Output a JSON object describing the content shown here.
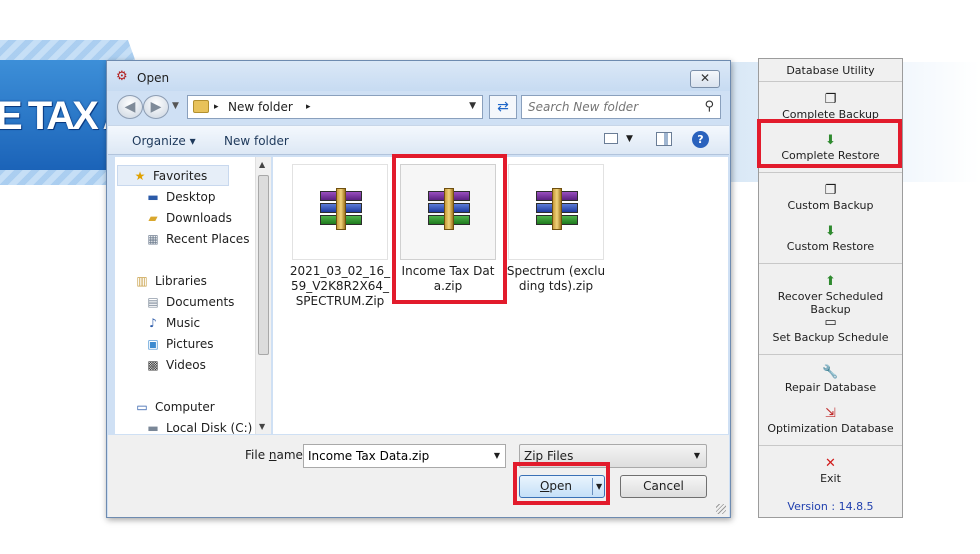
{
  "background": {
    "banner_title": "E TAX AU"
  },
  "utility": {
    "title": "Database Utility",
    "buttons": [
      {
        "label": "Complete Backup",
        "icon": "copy-icon"
      },
      {
        "label": "Complete Restore",
        "icon": "restore-icon"
      },
      {
        "label": "Custom Backup",
        "icon": "copy-icon"
      },
      {
        "label": "Custom Restore",
        "icon": "restore-icon"
      },
      {
        "label": "Recover Scheduled Backup",
        "icon": "recover-icon"
      },
      {
        "label": "Set Backup Schedule",
        "icon": "calendar-icon"
      },
      {
        "label": "Repair Database",
        "icon": "wrench-icon"
      },
      {
        "label": "Optimization Database",
        "icon": "optimize-icon"
      },
      {
        "label": "Exit",
        "icon": "x-icon"
      }
    ],
    "version": "Version : 14.8.5"
  },
  "dialog": {
    "title": "Open",
    "close_glyph": "✕",
    "address": {
      "crumb_sep": "▸",
      "crumb": "New folder",
      "search_placeholder": "Search New folder"
    },
    "toolbar": {
      "organize": "Organize ▾",
      "new_folder": "New folder",
      "help": "?"
    },
    "nav": [
      {
        "label": "Favorites",
        "icon": "star-icon"
      },
      {
        "label": "Desktop",
        "icon": "desktop-icon"
      },
      {
        "label": "Downloads",
        "icon": "downloads-icon"
      },
      {
        "label": "Recent Places",
        "icon": "recent-places-icon"
      },
      {
        "label": "Libraries",
        "icon": "libraries-icon"
      },
      {
        "label": "Documents",
        "icon": "documents-icon"
      },
      {
        "label": "Music",
        "icon": "music-icon"
      },
      {
        "label": "Pictures",
        "icon": "pictures-icon"
      },
      {
        "label": "Videos",
        "icon": "videos-icon"
      },
      {
        "label": "Computer",
        "icon": "computer-icon"
      },
      {
        "label": "Local Disk (C:)",
        "icon": "local-disk-icon"
      }
    ],
    "files": [
      {
        "name": "2021_03_02_16_59_V2K8R2X64_SPECTRUM.Zip",
        "icon": "winrar-archive-icon"
      },
      {
        "name": "Income Tax Data.zip",
        "icon": "winrar-archive-icon",
        "selected": true
      },
      {
        "name": "Spectrum (excluding tds).zip",
        "icon": "winrar-archive-icon"
      }
    ],
    "footer": {
      "file_name_label_pre": "File ",
      "file_name_label_key": "n",
      "file_name_label_post": "ame:",
      "file_name_value": "Income Tax Data.zip",
      "file_type": "Zip Files",
      "open_key": "O",
      "open_rest": "pen",
      "cancel": "Cancel"
    }
  },
  "colors": {
    "highlight": "#e21b2c",
    "version_text": "#1f3fae"
  }
}
